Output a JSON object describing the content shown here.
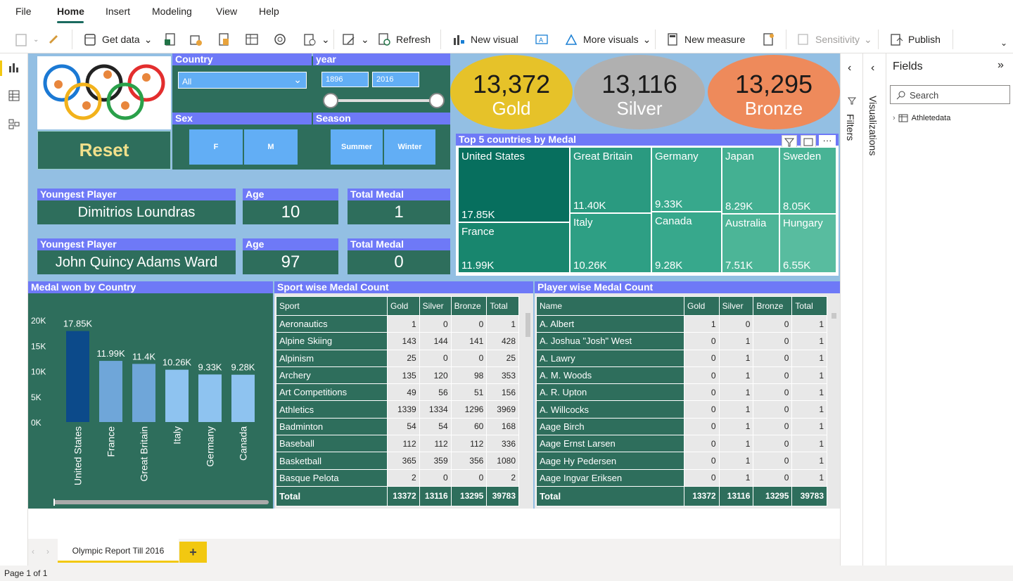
{
  "menu": [
    "File",
    "Home",
    "Insert",
    "Modeling",
    "View",
    "Help"
  ],
  "ribbon": {
    "get_data": "Get data",
    "refresh": "Refresh",
    "new_visual": "New visual",
    "more_visuals": "More visuals",
    "new_measure": "New measure",
    "sensitivity": "Sensitivity",
    "publish": "Publish"
  },
  "slicers": {
    "country_title": "Country",
    "country_value": "All",
    "year_title": "year",
    "year_from": "1896",
    "year_to": "2016",
    "sex_title": "Sex",
    "sex_options": [
      "F",
      "M"
    ],
    "season_title": "Season",
    "season_options": [
      "Summer",
      "Winter"
    ],
    "reset_label": "Reset"
  },
  "cards": {
    "youngest_title": "Youngest Player",
    "youngest_name": "Dimitrios Loundras",
    "age_title": "Age",
    "youngest_age": "10",
    "total_medal_title": "Total Medal",
    "youngest_medals": "1",
    "oldest_title": "Youngest Player",
    "oldest_name": "John Quincy Adams Ward",
    "oldest_age": "97",
    "oldest_medals": "0"
  },
  "medals": {
    "gold_value": "13,372",
    "gold_label": "Gold",
    "silver_value": "13,116",
    "silver_label": "Silver",
    "bronze_value": "13,295",
    "bronze_label": "Bronze"
  },
  "treemap": {
    "title": "Top 5 countries by Medal",
    "cells": [
      {
        "name": "United States",
        "value": "17.85K"
      },
      {
        "name": "France",
        "value": "11.99K"
      },
      {
        "name": "Great Britain",
        "value": "11.40K"
      },
      {
        "name": "Italy",
        "value": "10.26K"
      },
      {
        "name": "Germany",
        "value": "9.33K"
      },
      {
        "name": "Canada",
        "value": "9.28K"
      },
      {
        "name": "Japan",
        "value": "8.29K"
      },
      {
        "name": "Australia",
        "value": "7.51K"
      },
      {
        "name": "Sweden",
        "value": "8.05K"
      },
      {
        "name": "Hungary",
        "value": "6.55K"
      }
    ]
  },
  "chart_data": {
    "type": "bar",
    "title": "Medal won by Country",
    "categories": [
      "United States",
      "France",
      "Great Britain",
      "Italy",
      "Germany",
      "Canada"
    ],
    "values": [
      17850,
      11990,
      11400,
      10260,
      9330,
      9280
    ],
    "data_labels": [
      "17.85K",
      "11.99K",
      "11.4K",
      "10.26K",
      "9.33K",
      "9.28K"
    ],
    "ylim": [
      0,
      20000
    ],
    "yticks": [
      "0K",
      "5K",
      "10K",
      "15K",
      "20K"
    ],
    "colors": [
      "#0c4a8a",
      "#6fa6d9",
      "#6fa6d9",
      "#8ec3f0",
      "#8ec3f0",
      "#8ec3f0"
    ]
  },
  "sport_table": {
    "title": "Sport wise Medal Count",
    "columns": [
      "Sport",
      "Gold",
      "Silver",
      "Bronze",
      "Total"
    ],
    "rows": [
      [
        "Aeronautics",
        "1",
        "0",
        "0",
        "1"
      ],
      [
        "Alpine Skiing",
        "143",
        "144",
        "141",
        "428"
      ],
      [
        "Alpinism",
        "25",
        "0",
        "0",
        "25"
      ],
      [
        "Archery",
        "135",
        "120",
        "98",
        "353"
      ],
      [
        "Art Competitions",
        "49",
        "56",
        "51",
        "156"
      ],
      [
        "Athletics",
        "1339",
        "1334",
        "1296",
        "3969"
      ],
      [
        "Badminton",
        "54",
        "54",
        "60",
        "168"
      ],
      [
        "Baseball",
        "112",
        "112",
        "112",
        "336"
      ],
      [
        "Basketball",
        "365",
        "359",
        "356",
        "1080"
      ],
      [
        "Basque Pelota",
        "2",
        "0",
        "0",
        "2"
      ]
    ],
    "total": [
      "Total",
      "13372",
      "13116",
      "13295",
      "39783"
    ]
  },
  "player_table": {
    "title": "Player wise Medal Count",
    "columns": [
      "Name",
      "Gold",
      "Silver",
      "Bronze",
      "Total"
    ],
    "rows": [
      [
        "A. Albert",
        "1",
        "0",
        "0",
        "1"
      ],
      [
        "A. Joshua \"Josh\" West",
        "0",
        "1",
        "0",
        "1"
      ],
      [
        "A. Lawry",
        "0",
        "1",
        "0",
        "1"
      ],
      [
        "A. M. Woods",
        "0",
        "1",
        "0",
        "1"
      ],
      [
        "A. R. Upton",
        "0",
        "1",
        "0",
        "1"
      ],
      [
        "A. Willcocks",
        "0",
        "1",
        "0",
        "1"
      ],
      [
        "Aage Birch",
        "0",
        "1",
        "0",
        "1"
      ],
      [
        "Aage Ernst Larsen",
        "0",
        "1",
        "0",
        "1"
      ],
      [
        "Aage Hy Pedersen",
        "0",
        "1",
        "0",
        "1"
      ],
      [
        "Aage Ingvar Eriksen",
        "0",
        "1",
        "0",
        "1"
      ]
    ],
    "total": [
      "Total",
      "13372",
      "13116",
      "13295",
      "39783"
    ]
  },
  "panes": {
    "filters": "Filters",
    "visualizations": "Visualizations",
    "fields_title": "Fields",
    "search_placeholder": "Search",
    "table_name": "Athletedata"
  },
  "tab": {
    "name": "Olympic Report Till 2016",
    "add": "+"
  },
  "status": {
    "page": "Page 1 of 1"
  },
  "colors": {
    "gold": "#e6c229",
    "silver": "#b0b0b0",
    "bronze": "#ee8a5b",
    "teal": "#2e6e5c",
    "header": "#6e79f7"
  }
}
